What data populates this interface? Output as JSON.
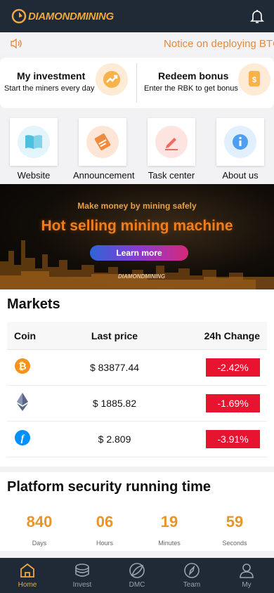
{
  "header": {
    "logo_text": "DIAMONDMINING"
  },
  "notice": {
    "text": "Notice on deploying BTC"
  },
  "investment": [
    {
      "title": "My investment",
      "subtitle": "Start the miners every day",
      "icon": "chart-up-icon"
    },
    {
      "title": "Redeem bonus",
      "subtitle": "Enter the RBK to get bonus",
      "icon": "coin-scroll-icon"
    }
  ],
  "quick_links": [
    {
      "label": "Website",
      "icon": "book-icon",
      "color": "#e3f4fa"
    },
    {
      "label": "Announcement",
      "icon": "megaphone-icon",
      "color": "#fde6d6"
    },
    {
      "label": "Task center",
      "icon": "pen-icon",
      "color": "#fde4e1"
    },
    {
      "label": "About us",
      "icon": "info-icon",
      "color": "#e2effd"
    }
  ],
  "banner": {
    "tagline": "Make money by mining safely",
    "headline": "Hot selling mining machine",
    "button": "Learn more",
    "logo": "DIAMONDMINING"
  },
  "markets": {
    "title": "Markets",
    "columns": [
      "Coin",
      "Last price",
      "24h Change"
    ],
    "rows": [
      {
        "coin_icon": "bitcoin-icon",
        "price": "$ 83877.44",
        "change": "-2.42%"
      },
      {
        "coin_icon": "ethereum-icon",
        "price": "$ 1885.82",
        "change": "-1.69%"
      },
      {
        "coin_icon": "filecoin-icon",
        "price": "$ 2.809",
        "change": "-3.91%"
      }
    ]
  },
  "security": {
    "title": "Platform security running time",
    "stats": [
      {
        "value": "840",
        "label": "Days"
      },
      {
        "value": "06",
        "label": "Hours"
      },
      {
        "value": "19",
        "label": "Minutes"
      },
      {
        "value": "59",
        "label": "Seconds"
      }
    ]
  },
  "tabs": [
    {
      "label": "Home",
      "icon": "home-icon",
      "active": true
    },
    {
      "label": "Invest",
      "icon": "coins-icon",
      "active": false
    },
    {
      "label": "DMC",
      "icon": "leaf-icon",
      "active": false
    },
    {
      "label": "Team",
      "icon": "compass-icon",
      "active": false
    },
    {
      "label": "My",
      "icon": "user-icon",
      "active": false
    }
  ],
  "colors": {
    "accent": "#f0a742",
    "header_bg": "#1f2a36",
    "down": "#e8132f",
    "stat": "#e8962a"
  }
}
